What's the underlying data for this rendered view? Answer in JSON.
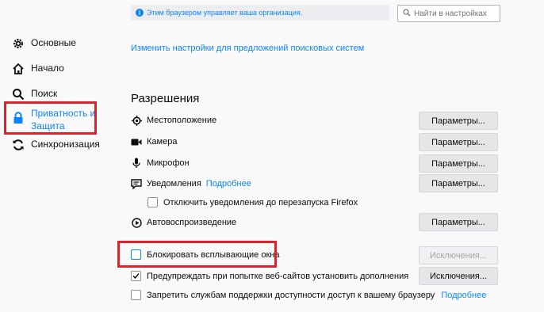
{
  "sidebar": {
    "items": [
      {
        "label": "Основные",
        "icon": "gear-icon"
      },
      {
        "label": "Начало",
        "icon": "home-icon"
      },
      {
        "label": "Поиск",
        "icon": "search-icon"
      },
      {
        "label": "Приватность и Защита",
        "icon": "lock-icon",
        "active": true
      },
      {
        "label": "Синхронизация",
        "icon": "sync-icon"
      }
    ]
  },
  "header": {
    "policy_notice": "Этим браузером управляет ваша организация.",
    "search_placeholder": "Найти в настройках"
  },
  "main": {
    "change_search_suggestions_link": "Изменить настройки для предложений поисковых систем",
    "permissions_title": "Разрешения",
    "permissions": [
      {
        "label": "Местоположение",
        "icon": "location-icon",
        "button": "Параметры..."
      },
      {
        "label": "Камера",
        "icon": "camera-icon",
        "button": "Параметры..."
      },
      {
        "label": "Микрофон",
        "icon": "microphone-icon",
        "button": "Параметры..."
      },
      {
        "label": "Уведомления",
        "icon": "notification-icon",
        "button": "Параметры...",
        "more_link": "Подробнее"
      },
      {
        "label": "Автовоспроизведение",
        "icon": "autoplay-icon",
        "button": "Параметры..."
      }
    ],
    "pause_notifications_label": "Отключить уведомления до перезапуска Firefox",
    "block_popups_label": "Блокировать всплывающие окна",
    "block_popups_exceptions": "Исключения...",
    "warn_addons_label": "Предупреждать при попытке веб-сайтов установить дополнения",
    "warn_addons_exceptions": "Исключения...",
    "accessibility_label": "Запретить службам поддержки доступности доступ к вашему браузеру",
    "accessibility_more": "Подробнее"
  },
  "colors": {
    "accent": "#0a84ff",
    "highlight_box": "#d7262e"
  }
}
